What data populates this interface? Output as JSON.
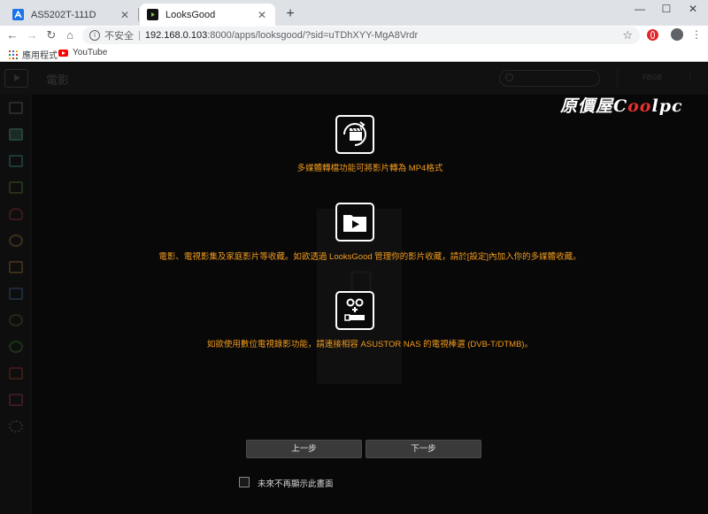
{
  "browser": {
    "tabs": [
      {
        "title": "AS5202T-111D",
        "active": false
      },
      {
        "title": "LooksGood",
        "active": true
      }
    ],
    "address": {
      "security_label": "不安全",
      "host": "192.168.0.103",
      "path": ":8000/apps/looksgood/?sid=uTDhXYY-MgA8Vrdr"
    },
    "bookmarks": [
      {
        "label": "應用程式",
        "icon": "apps-grid-icon"
      },
      {
        "label": "YouTube",
        "icon": "youtube-icon"
      }
    ]
  },
  "app": {
    "header_title": "電影",
    "user_label": "FBGB",
    "watermark": {
      "prefix": "原價屋C",
      "o": "oo",
      "suffix": "lpc"
    }
  },
  "features": [
    {
      "icon": "convert-video-icon",
      "text": "多媒體轉檔功能可將影片轉為 MP4格式"
    },
    {
      "icon": "video-folder-icon",
      "text": "電影、電視影集及家庭影片等收藏。如欲透過 LooksGood 管理你的影片收藏，請於[設定]內加入你的多媒體收藏。"
    },
    {
      "icon": "tv-tuner-icon",
      "text": "如欲使用數位電視錄影功能，請連接相容 ASUSTOR NAS 的電視棒選 (DVB-T/DTMB)。"
    }
  ],
  "wizard": {
    "prev_label": "上一步",
    "next_label": "下一步",
    "dont_show_label": "未來不再顯示此畫面",
    "dont_show_checked": false
  },
  "colors": {
    "accent_text": "#f39c1e",
    "background": "#080808"
  }
}
